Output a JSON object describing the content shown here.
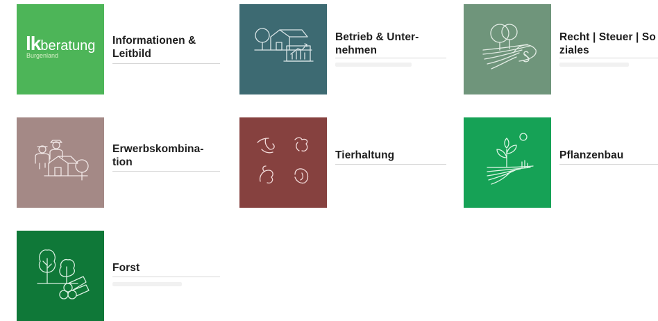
{
  "tiles": [
    {
      "title": "Informationen &\nLeitbild",
      "color": "#4db558",
      "icon": "lk-beratung-logo"
    },
    {
      "title": "Betrieb & Unter-\nnehmen",
      "color": "#3d6a72",
      "icon": "farm-business-icon"
    },
    {
      "title": "Recht | Steuer | So\nziales",
      "color": "#6f957b",
      "icon": "law-tax-icon"
    },
    {
      "title": "Erwerbskombina-\ntion",
      "color": "#a48986",
      "icon": "farmers-icon"
    },
    {
      "title": "Tierhaltung",
      "color": "#86413f",
      "icon": "livestock-icon"
    },
    {
      "title": "Pflanzenbau",
      "color": "#16a256",
      "icon": "plant-field-icon"
    },
    {
      "title": "Forst",
      "color": "#0f7838",
      "icon": "forest-icon"
    }
  ],
  "logo": {
    "lk": "lk",
    "word": "beratung",
    "region": "Burgenland"
  }
}
